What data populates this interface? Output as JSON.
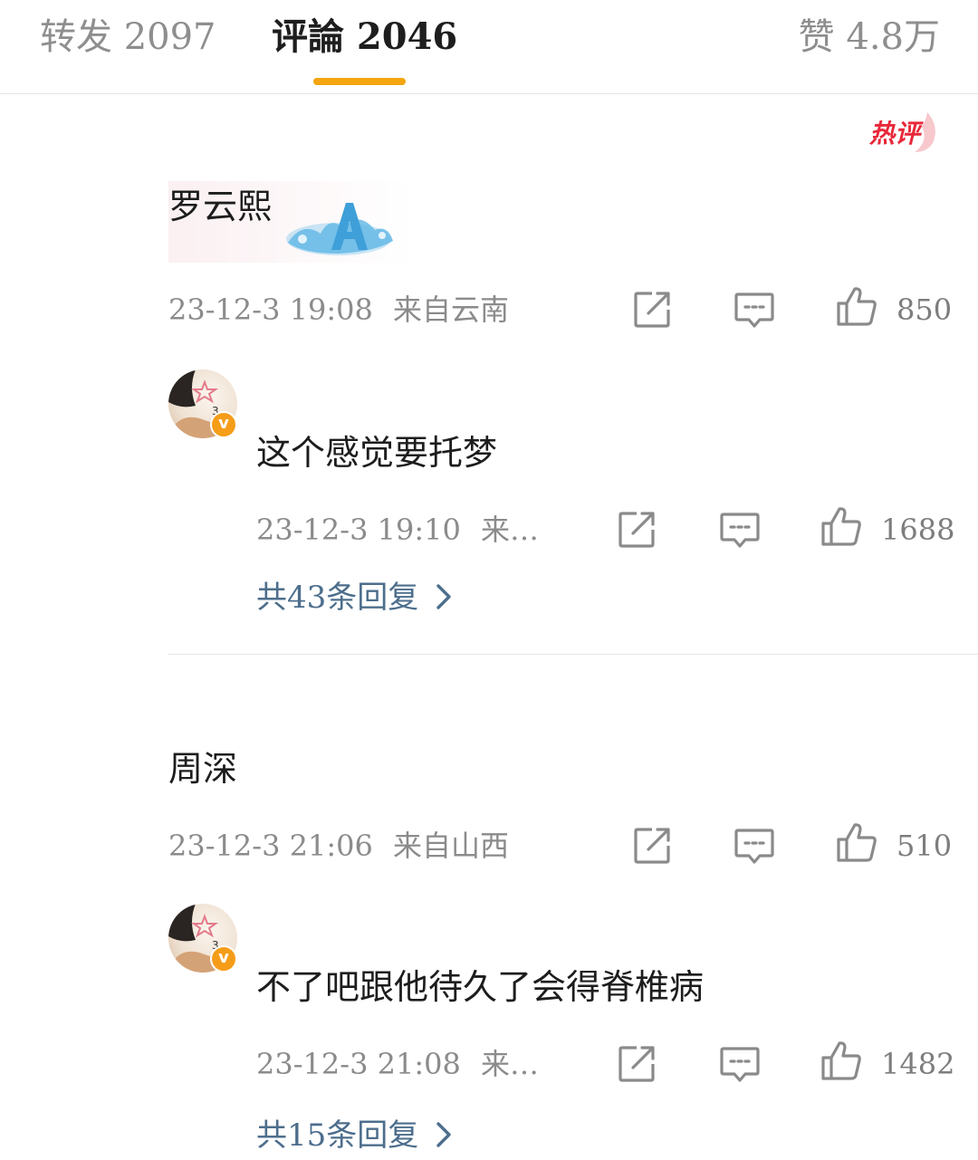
{
  "tabs": {
    "repost": "转发 2097",
    "comment": "评論 2046",
    "like": "赞 4.8万"
  },
  "hot_badge": "热评",
  "comments": [
    {
      "name": "罗云熙",
      "time": "23-12-3 19:08",
      "location": "来自云南",
      "likes": "850",
      "reply": {
        "text": "这个感觉要托梦",
        "time": "23-12-3 19:10",
        "location": "来…",
        "likes": "1688"
      },
      "reply_link": "共43条回复"
    },
    {
      "name": "周深",
      "time": "23-12-3 21:06",
      "location": "来自山西",
      "likes": "510",
      "reply": {
        "text": "不了吧跟他待久了会得脊椎病",
        "time": "23-12-3 21:08",
        "location": "来…",
        "likes": "1482"
      },
      "reply_link": "共15条回复"
    }
  ],
  "icons": {
    "share": "share-icon",
    "comment": "comment-icon",
    "like": "thumbs-up-icon",
    "chevron": "chevron-right-icon",
    "verified": "verified-badge-icon"
  },
  "colors": {
    "accent_underline": "#f4a50f",
    "reply_link": "#4d6e8c",
    "hot_badge": "#e8283a",
    "verified_badge": "#f59d19"
  }
}
